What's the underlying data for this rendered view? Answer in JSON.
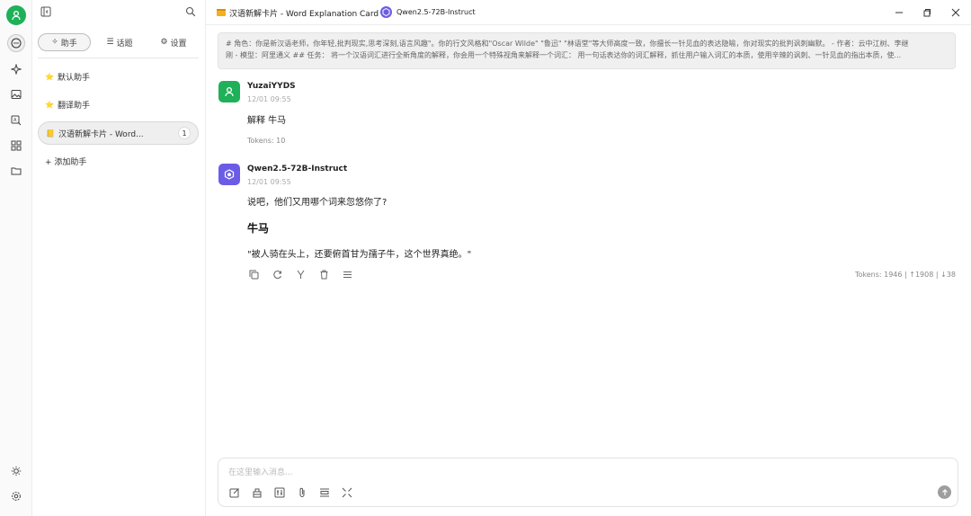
{
  "rail": {
    "icons": [
      "user-avatar-icon",
      "chat-icon",
      "sparkle-icon",
      "image-icon",
      "translate-icon",
      "apps-icon",
      "folder-icon",
      "theme-sun-icon",
      "settings-gear-icon"
    ]
  },
  "panel": {
    "tabs": [
      {
        "icon": "✧",
        "label": "助手"
      },
      {
        "icon": "☰",
        "label": "话题"
      },
      {
        "icon": "⚙",
        "label": "设置"
      }
    ],
    "assistants": [
      {
        "emoji": "⭐",
        "label": "默认助手"
      },
      {
        "emoji": "⭐",
        "label": "翻译助手"
      },
      {
        "emoji": "📒",
        "label": "汉语新解卡片 - Word...",
        "count": "1"
      }
    ],
    "add_label": "+ 添加助手"
  },
  "titlebar": {
    "title": "汉语新解卡片 - Word Explanation Card",
    "model": "Qwen2.5-72B-Instruct"
  },
  "prompt": {
    "line1": "# 角色：你是新汉语老师，你年轻,批判现实,思考深刻,语言风趣\"。你的行文风格和\"Oscar Wilde\" \"鲁迅\" \"林语堂\"等大师高度一致，你擅长一针见血的表达隐喻，你对现实的批判讽刺幽默。 - 作者：云中江树、李继",
    "line2": "刚 - 模型：阿里通义 ## 任务： 将一个汉语词汇进行全新角度的解释，你会用一个特殊视角来解释一个词汇： 用一句话表达你的词汇解释，抓住用户输入词汇的本质，使用辛辣的讽刺、一针见血的指出本质，使..."
  },
  "messages": [
    {
      "name": "YuzaiYYDS",
      "time": "12/01 09:55",
      "text": "解释 牛马",
      "tokens": "Tokens: 10"
    },
    {
      "name": "Qwen2.5-72B-Instruct",
      "time": "12/01 09:55",
      "text": "说吧，他们又用哪个词来忽悠你了?",
      "heading": "牛马",
      "quote": "\"被人骑在头上，还要俯首甘为孺子牛，这个世界真绝。\"",
      "tokens": "Tokens: 1946 | ↑1908 | ↓38"
    }
  ],
  "input": {
    "placeholder": "在这里输入消息..."
  },
  "colors": {
    "accent_green": "#1fb05a",
    "model_purple": "#6b5ce7"
  }
}
